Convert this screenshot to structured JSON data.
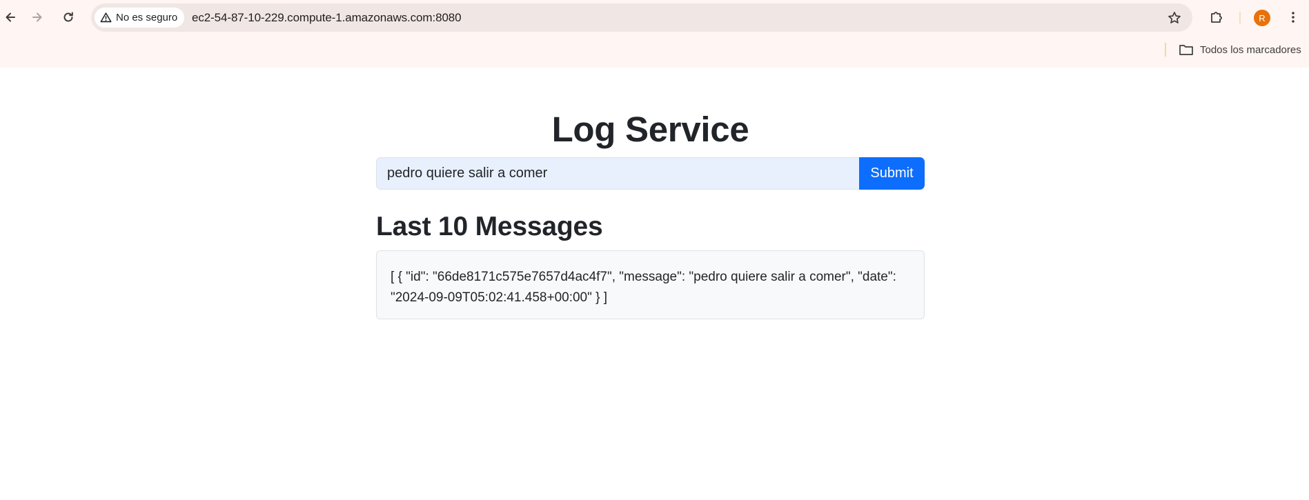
{
  "browser": {
    "security_label": "No es seguro",
    "url": "ec2-54-87-10-229.compute-1.amazonaws.com:8080",
    "avatar_initial": "R",
    "avatar_color": "#e8710a",
    "bookmarks_folder_label": "Todos los marcadores",
    "icons": [
      "back-arrow-icon",
      "forward-arrow-icon",
      "reload-icon",
      "warning-icon",
      "star-icon",
      "extensions-icon",
      "kebab-menu-icon",
      "folder-icon"
    ]
  },
  "page": {
    "title": "Log Service",
    "input": {
      "value": "pedro quiere salir a comer",
      "background_color": "#e8f0fe"
    },
    "submit_label": "Submit",
    "submit_color": "#0d6efd",
    "messages_heading": "Last 10 Messages",
    "messages_json": "[ { \"id\": \"66de8171c575e7657d4ac4f7\", \"message\": \"pedro quiere salir a comer\", \"date\": \"2024-09-09T05:02:41.458+00:00\" } ]"
  }
}
